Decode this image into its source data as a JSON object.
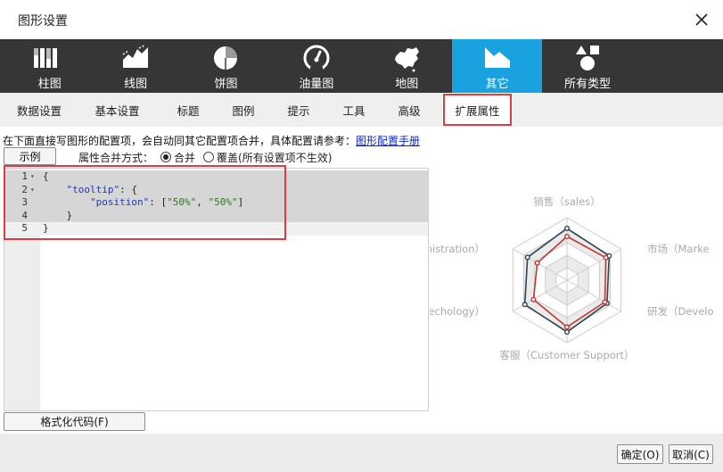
{
  "window": {
    "title": "图形设置"
  },
  "chart_types": [
    {
      "label": "柱图",
      "icon": "bar-chart-icon"
    },
    {
      "label": "线图",
      "icon": "area-chart-icon"
    },
    {
      "label": "饼图",
      "icon": "pie-chart-icon"
    },
    {
      "label": "油量图",
      "icon": "gauge-icon"
    },
    {
      "label": "地图",
      "icon": "china-map-icon"
    },
    {
      "label": "其它",
      "icon": "other-chart-icon",
      "active": true
    },
    {
      "label": "所有类型",
      "icon": "all-types-icon"
    }
  ],
  "tabs": [
    {
      "label": "数据设置"
    },
    {
      "label": "基本设置"
    },
    {
      "label": "标题"
    },
    {
      "label": "图例"
    },
    {
      "label": "提示"
    },
    {
      "label": "工具"
    },
    {
      "label": "高级"
    },
    {
      "label": "扩展属性",
      "active": true
    }
  ],
  "hint": {
    "text": "在下面直接写图形的配置项，会自动同其它配置项合并，具体配置请参考：",
    "link": "图形配置手册"
  },
  "example_button": "示例",
  "merge": {
    "label": "属性合并方式：",
    "options": [
      "合并",
      "覆盖(所有设置项不生效)"
    ],
    "selected": "合并"
  },
  "editor": {
    "lines": [
      {
        "num": "1",
        "fold": "▾",
        "text": "{"
      },
      {
        "num": "2",
        "fold": "▾",
        "text": "    \"tooltip\": {"
      },
      {
        "num": "3",
        "fold": "",
        "text": "        \"position\": [\"50%\", \"50%\"]"
      },
      {
        "num": "4",
        "fold": "",
        "text": "    }"
      },
      {
        "num": "5",
        "fold": "",
        "text": "}"
      }
    ]
  },
  "format_button": "格式化代码(F)",
  "footer": {
    "ok": "确定(O)",
    "cancel": "取消(C)"
  },
  "chart_data": {
    "type": "radar",
    "indicators": [
      "销售（sales）",
      "市场（Marke",
      "研发（Develo",
      "客服（Customer Support）",
      "Techology）",
      "inistration）"
    ],
    "series": [
      {
        "values": [
          0.83,
          0.78,
          0.74,
          0.83,
          0.78,
          0.73
        ],
        "color": "#2f4554"
      },
      {
        "values": [
          0.7,
          0.72,
          0.7,
          0.75,
          0.62,
          0.55
        ],
        "color": "#c23531"
      }
    ],
    "colors": {
      "grid": "#cccccc",
      "band_fill": "#ebebeb",
      "label": "#aaaaaa"
    }
  },
  "colors": {
    "accent": "#1aa2e0",
    "highlight": "#e33b3b",
    "link": "#0b25cc",
    "type_bar": "#363636"
  }
}
